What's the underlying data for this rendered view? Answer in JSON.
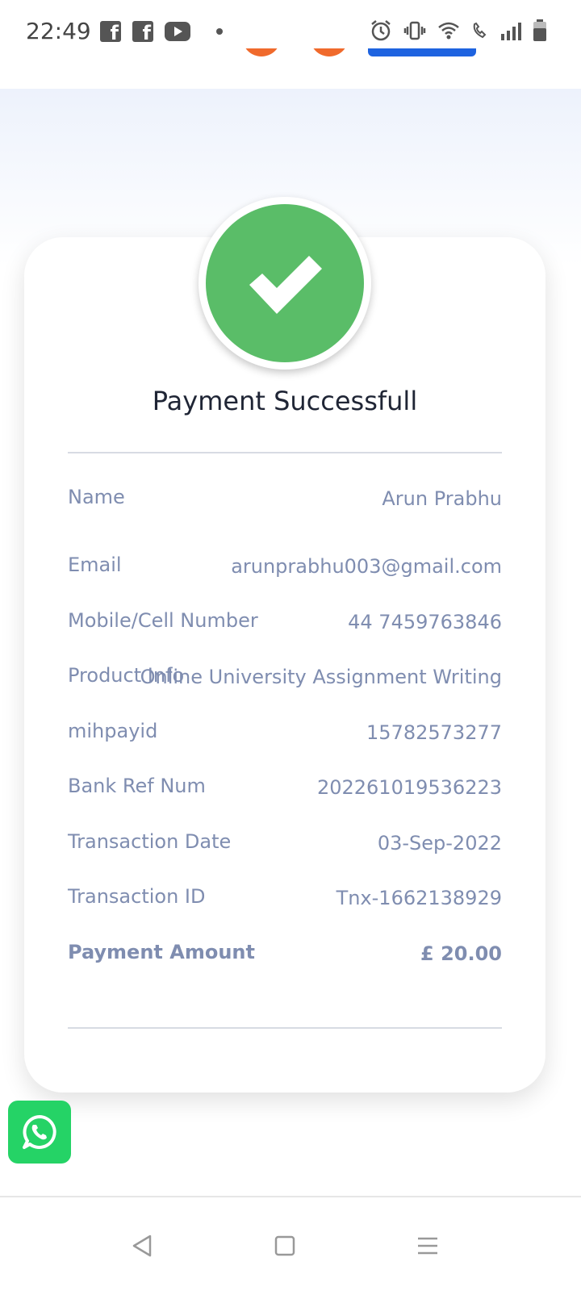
{
  "status_bar": {
    "time": "22:49",
    "left_icons": [
      "facebook-icon",
      "facebook-icon",
      "youtube-icon",
      "dot-icon"
    ],
    "right_icons": [
      "alarm-icon",
      "vibrate-icon",
      "wifi-icon",
      "wifi-call-icon",
      "signal-icon",
      "battery-icon"
    ]
  },
  "colors": {
    "success": "#5abd68",
    "text_muted": "#7f8db0",
    "title": "#1f2535",
    "whatsapp": "#25d366",
    "accent_orange": "#f06a2c",
    "accent_blue": "#1e63e0"
  },
  "payment": {
    "title": "Payment Successfull",
    "rows": [
      {
        "label": "Name",
        "value": "Arun Prabhu"
      },
      {
        "label": "Email",
        "value": "arunprabhu003@gmail.com"
      },
      {
        "label": "Mobile/Cell Number",
        "value": "44 7459763846"
      },
      {
        "label": "Product Info",
        "value": "Online University Assignment Writing"
      },
      {
        "label": "mihpayid",
        "value": "15782573277"
      },
      {
        "label": "Bank Ref Num",
        "value": "202261019536223"
      },
      {
        "label": "Transaction Date",
        "value": "03-Sep-2022"
      },
      {
        "label": "Transaction ID",
        "value": "Tnx-1662138929"
      }
    ],
    "total": {
      "label": "Payment Amount",
      "value": "£ 20.00"
    }
  },
  "floating": {
    "icon": "whatsapp-icon"
  },
  "nav_bar": {
    "buttons": [
      "back-icon",
      "home-icon",
      "menu-icon"
    ]
  }
}
